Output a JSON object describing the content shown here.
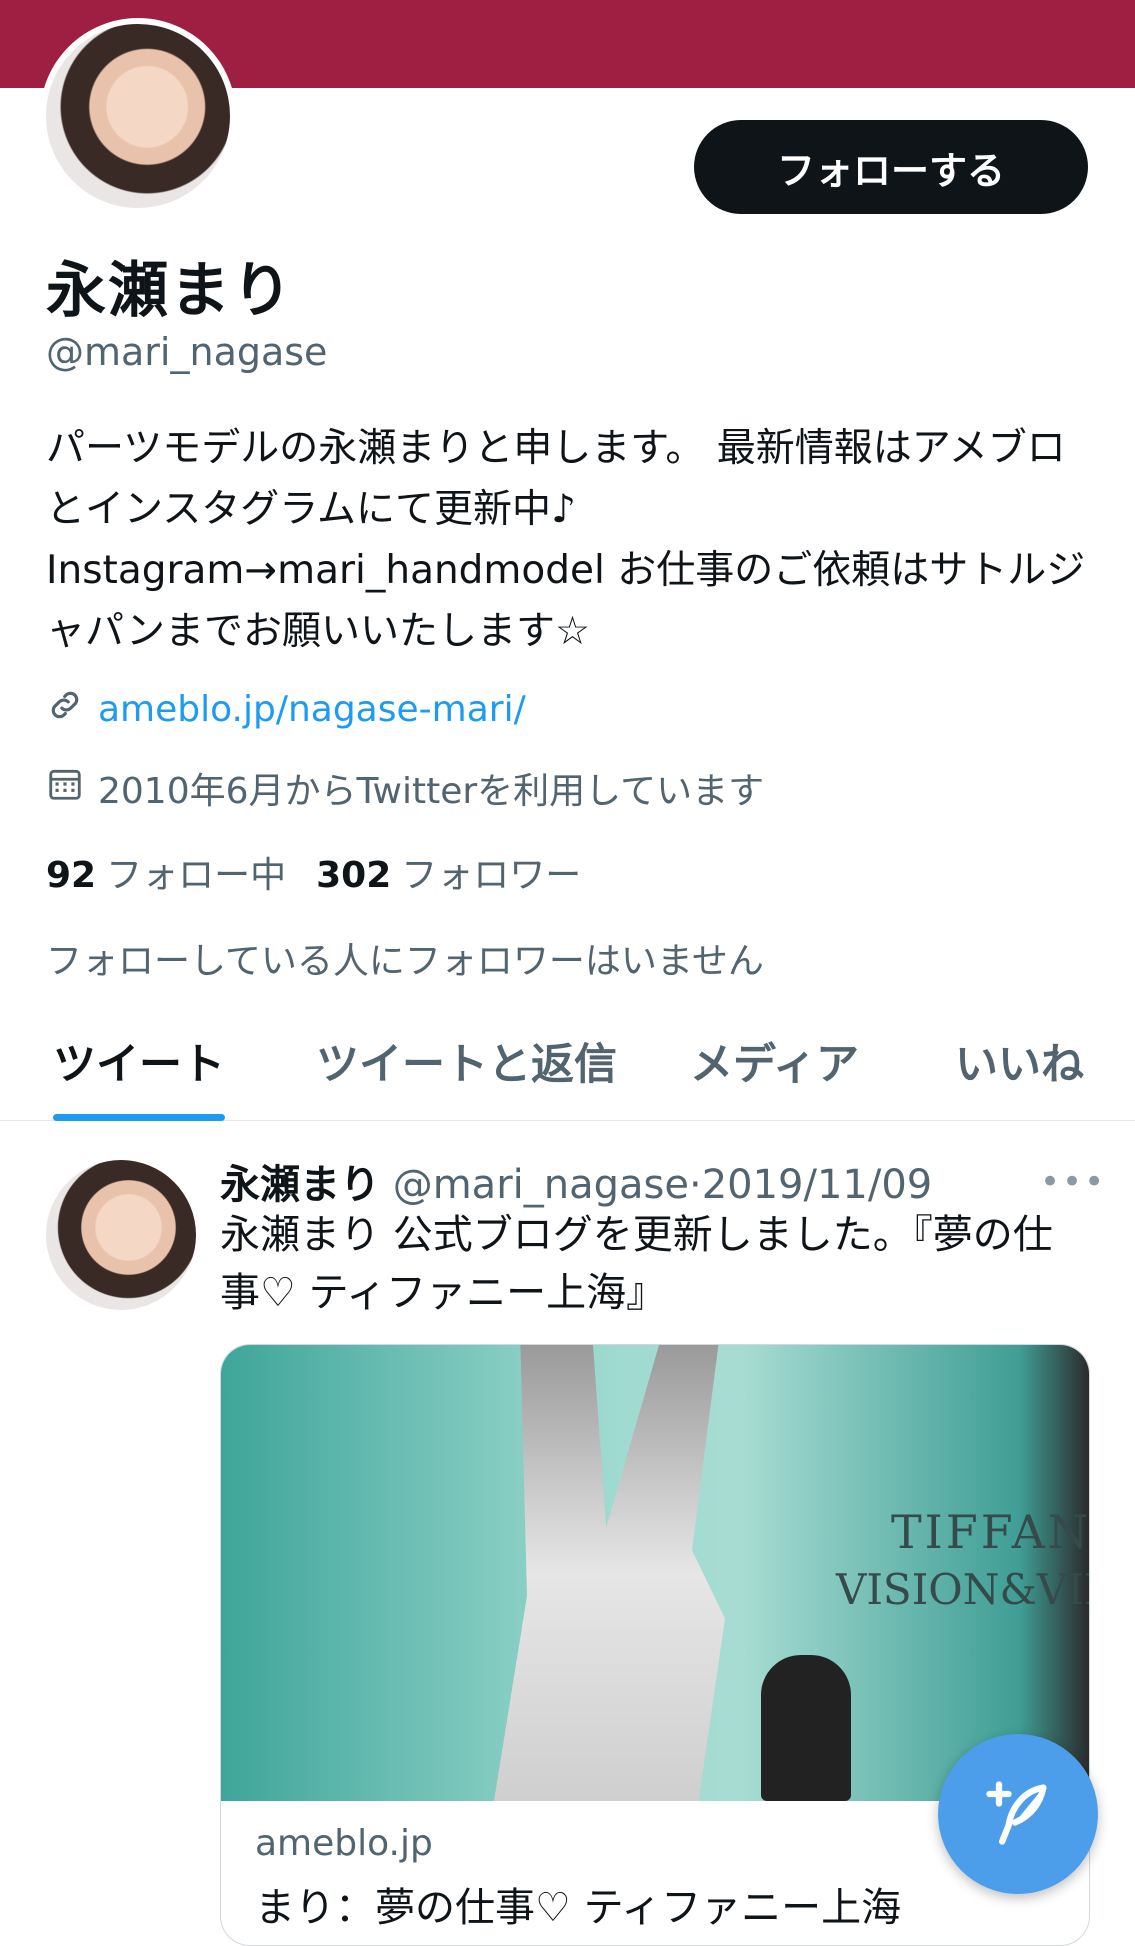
{
  "profile": {
    "name": "永瀬まり",
    "handle": "@mari_nagase",
    "follow_label": "フォローする",
    "bio": "パーツモデルの永瀬まりと申します。 最新情報はアメブロとインスタグラムにて更新中♪ Instagram→mari_handmodel お仕事のご依頼はサトルジャパンまでお願いいたします☆",
    "link": "ameblo.jp/nagase-mari/",
    "joined": "2010年6月からTwitterを利用しています",
    "following_count": "92",
    "following_label": "フォロー中",
    "followers_count": "302",
    "followers_label": "フォロワー",
    "no_followers_you_know": "フォローしている人にフォロワーはいません"
  },
  "tabs": [
    {
      "label": "ツイート",
      "active": true
    },
    {
      "label": "ツイートと返信",
      "active": false
    },
    {
      "label": "メディア",
      "active": false
    },
    {
      "label": "いいね",
      "active": false
    }
  ],
  "tweet": {
    "name": "永瀬まり",
    "handle": "@mari_nagase",
    "separator": "·",
    "date": "2019/11/09",
    "more": "•••",
    "text": "永瀬まり 公式ブログを更新しました。『夢の仕事♡ ティファニー上海』",
    "card": {
      "domain": "ameblo.jp",
      "title": "まり：夢の仕事♡ ティファニー上海",
      "image_text_1": "TIFFANY",
      "image_text_2": "VISION&VIRT"
    }
  },
  "colors": {
    "banner": "#9e1f41",
    "accent": "#1d9bf0",
    "fab": "#4c9eeb"
  },
  "icons": {
    "link": "link-icon",
    "calendar": "calendar-icon",
    "compose": "compose-tweet-icon"
  }
}
